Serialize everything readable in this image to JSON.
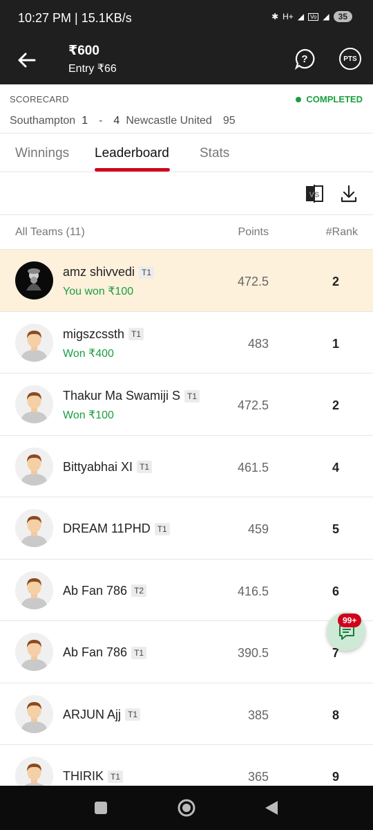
{
  "status_bar": {
    "time_speed": "10:27 PM | 15.1KB/s",
    "battery": "35",
    "net": "H+"
  },
  "header": {
    "amount": "₹600",
    "entry": "Entry ₹66",
    "pts_label": "PTS"
  },
  "scorecard": {
    "label": "SCORECARD",
    "status": "COMPLETED",
    "team1": "Southampton",
    "team1_score": "1",
    "separator": "-",
    "team2_score": "4",
    "team2": "Newcastle United",
    "time": "95"
  },
  "tabs": [
    {
      "label": "Winnings"
    },
    {
      "label": "Leaderboard"
    },
    {
      "label": "Stats"
    }
  ],
  "toolbar": {
    "compare_icon": "VS"
  },
  "table": {
    "col_teams": "All Teams (11)",
    "col_points": "Points",
    "col_rank": "#Rank"
  },
  "rows": [
    {
      "name": "amz shivvedi",
      "tag": "T1",
      "won": "You won ₹100",
      "points": "472.5",
      "rank": "2"
    },
    {
      "name": "migszcssth",
      "tag": "T1",
      "won": "Won ₹400",
      "points": "483",
      "rank": "1"
    },
    {
      "name": "Thakur Ma Swamiji S",
      "tag": "T1",
      "won": "Won ₹100",
      "points": "472.5",
      "rank": "2"
    },
    {
      "name": "Bittyabhai XI",
      "tag": "T1",
      "won": "",
      "points": "461.5",
      "rank": "4"
    },
    {
      "name": "DREAM 11PHD",
      "tag": "T1",
      "won": "",
      "points": "459",
      "rank": "5"
    },
    {
      "name": "Ab Fan 786",
      "tag": "T2",
      "won": "",
      "points": "416.5",
      "rank": "6"
    },
    {
      "name": "Ab Fan 786",
      "tag": "T1",
      "won": "",
      "points": "390.5",
      "rank": "7"
    },
    {
      "name": "ARJUN Ajj",
      "tag": "T1",
      "won": "",
      "points": "385",
      "rank": "8"
    },
    {
      "name": "THIRIK",
      "tag": "T1",
      "won": "",
      "points": "365",
      "rank": "9"
    }
  ],
  "chat": {
    "badge": "99+"
  },
  "colors": {
    "accent": "#d0021b",
    "success": "#1a9e3f",
    "header_bg": "#1f1f1f",
    "highlight_row": "#fdf1dc"
  }
}
